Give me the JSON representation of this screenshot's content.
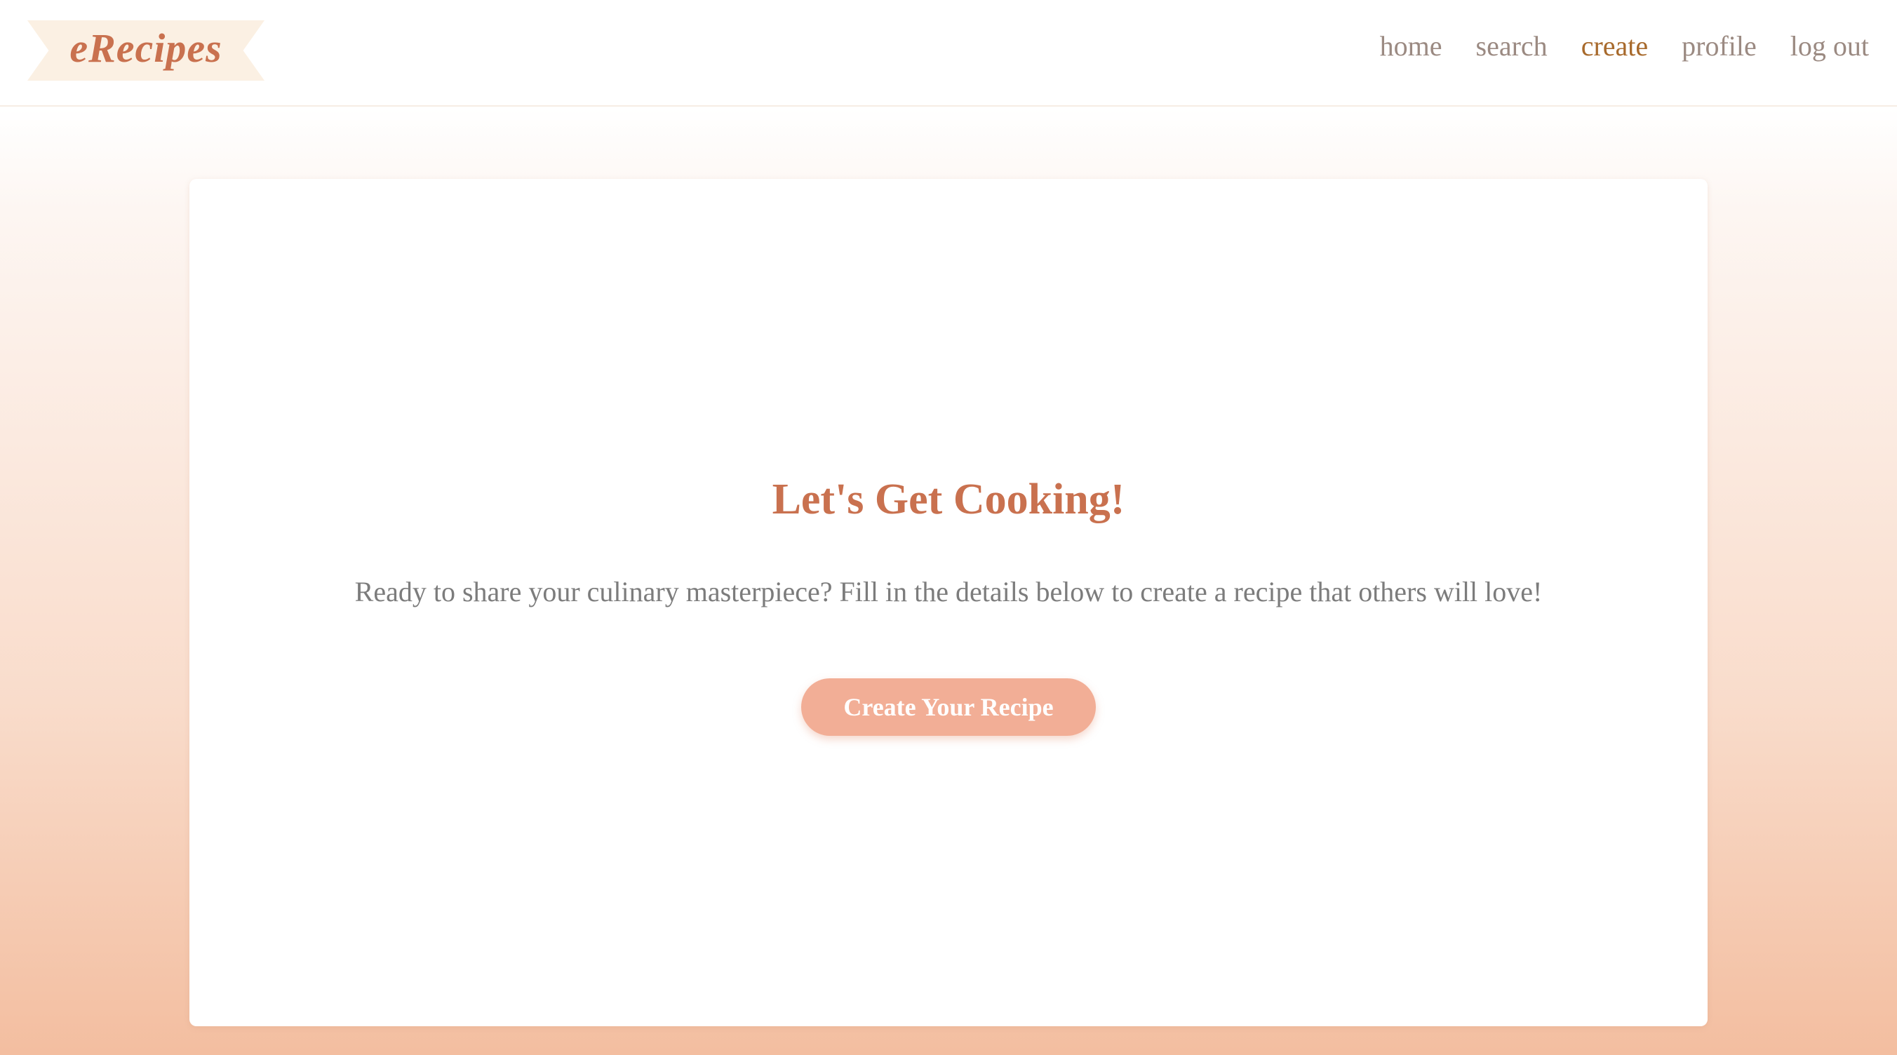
{
  "header": {
    "logo_text": "eRecipes",
    "nav": [
      {
        "label": "home",
        "active": false
      },
      {
        "label": "search",
        "active": false
      },
      {
        "label": "create",
        "active": true
      },
      {
        "label": "profile",
        "active": false
      },
      {
        "label": "log out",
        "active": false
      }
    ]
  },
  "main": {
    "title": "Let's Get Cooking!",
    "subtitle": "Ready to share your culinary masterpiece? Fill in the details below to create a recipe that others will love!",
    "cta_label": "Create Your Recipe"
  },
  "colors": {
    "brand": "#c9714f",
    "nav_text": "#9b8a82",
    "nav_active": "#a86a2c",
    "button_bg": "#f2ae96",
    "logo_ribbon": "#fbf0e3",
    "body_text": "#7c7c7c"
  }
}
